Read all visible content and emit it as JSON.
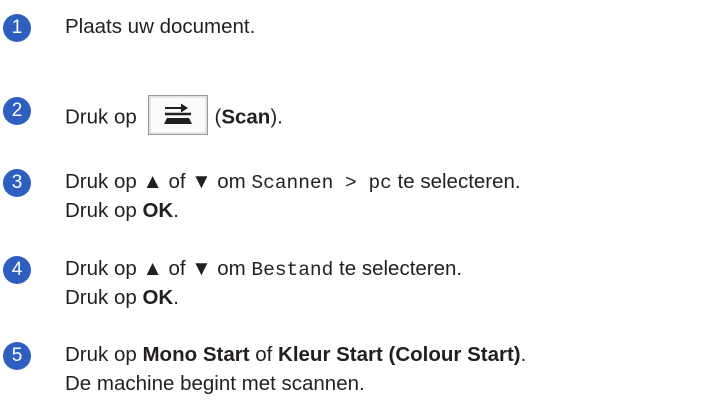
{
  "colors": {
    "badge": "#2d5ec0",
    "text": "#231f20"
  },
  "steps": [
    {
      "number": "1",
      "text": "Plaats uw document."
    },
    {
      "number": "2",
      "pre": "Druk op",
      "key_icon": "scan-key-icon",
      "post_open": "(",
      "bold": "Scan",
      "post_close": ")."
    },
    {
      "number": "3",
      "pre": "Druk op ▲ of ▼ om ",
      "mono": "Scannen > pc",
      "post": " te selecteren.",
      "line2_pre": "Druk op ",
      "line2_bold": "OK",
      "line2_post": "."
    },
    {
      "number": "4",
      "pre": "Druk op ▲ of ▼ om ",
      "mono": "Bestand",
      "post": " te selecteren.",
      "line2_pre": "Druk op ",
      "line2_bold": "OK",
      "line2_post": "."
    },
    {
      "number": "5",
      "pre": "Druk op ",
      "bold1": "Mono Start",
      "mid": " of ",
      "bold2": "Kleur Start (Colour Start)",
      "post": ".",
      "line2": "De machine begint met scannen."
    }
  ]
}
